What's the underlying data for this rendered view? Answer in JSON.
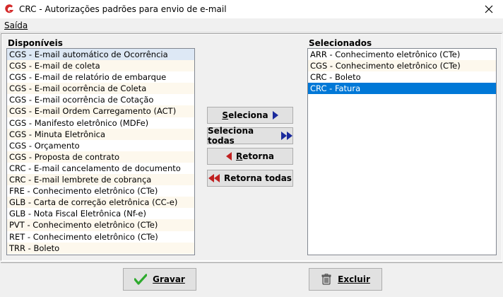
{
  "window": {
    "title": "CRC - Autorizações padrões para envio de e-mail"
  },
  "menu": {
    "items": [
      {
        "label": "Saída"
      }
    ]
  },
  "available": {
    "caption": "Disponíveis",
    "items": [
      "CGS - E-mail automático de Ocorrência",
      "CGS - E-mail de coleta",
      "CGS - E-mail de relatório de embarque",
      "CGS - E-mail ocorrência de Coleta",
      "CGS - E-mail ocorrência de Cotação",
      "CGS - E-mail Ordem Carregamento (ACT)",
      "CGS - Manifesto eletrônico (MDFe)",
      "CGS - Minuta Eletrônica",
      "CGS - Orçamento",
      "CGS - Proposta de contrato",
      "CRC - E-mail cancelamento de documento",
      "CRC - E-mail lembrete de cobrança",
      "FRE - Conhecimento eletrônico (CTe)",
      "GLB - Carta de correção eletrônica (CC-e)",
      "GLB - Nota Fiscal Eletrônica (Nf-e)",
      "PVT - Conhecimento eletrônico (CTe)",
      "RET - Conhecimento eletrônico (CTe)",
      "TRR - Boleto"
    ],
    "selected_index": 0
  },
  "selected": {
    "caption": "Selecionados",
    "items": [
      "ARR - Conhecimento eletrônico (CTe)",
      "CGS - Conhecimento eletrônico (CTe)",
      "CRC - Boleto",
      "CRC - Fatura"
    ],
    "selected_index": 3
  },
  "buttons": {
    "select": "Seleciona",
    "select_all": "Seleciona todas",
    "return": "Retorna",
    "return_all": "Retorna todas",
    "save": "Gravar",
    "delete": "Excluir"
  },
  "colors": {
    "arrow": "#1a2a9c",
    "selection": "#0078d7",
    "app_icon": "#d42a2a",
    "check": "#2eaa2e"
  }
}
